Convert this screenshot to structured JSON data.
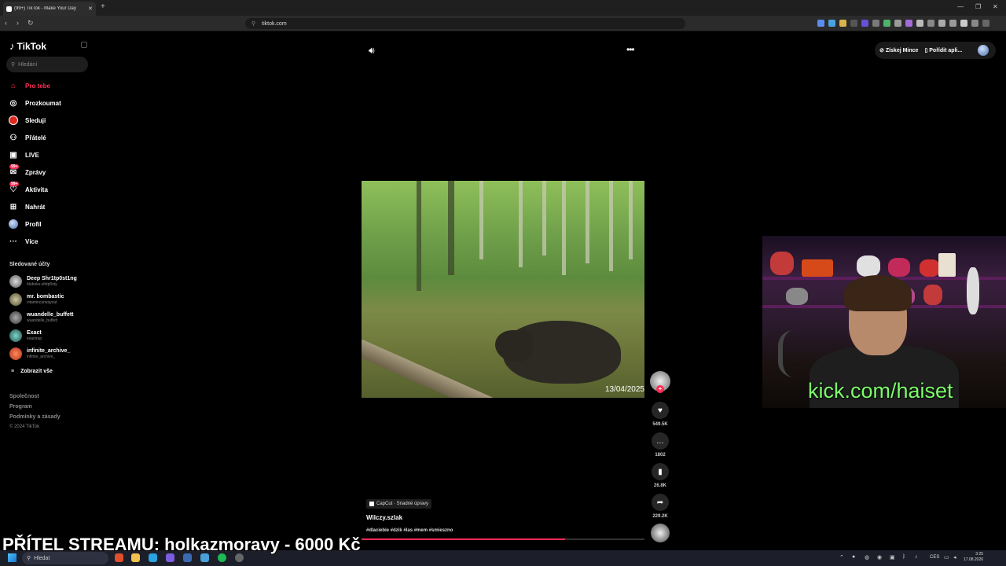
{
  "browser": {
    "tab_title": "(99+) TikTok - Make Your Day",
    "url": "tiktok.com"
  },
  "sidebar": {
    "logo": "TikTok",
    "search_placeholder": "Hledání",
    "nav": [
      {
        "label": "Pro tebe",
        "icon": "home-icon",
        "active": true
      },
      {
        "label": "Prozkoumat",
        "icon": "compass-icon"
      },
      {
        "label": "Sleduji",
        "icon": "following-icon"
      },
      {
        "label": "Přátelé",
        "icon": "friends-icon"
      },
      {
        "label": "LIVE",
        "icon": "live-icon"
      },
      {
        "label": "Zprávy",
        "icon": "messages-icon",
        "badge": "99+"
      },
      {
        "label": "Aktivita",
        "icon": "activity-icon",
        "badge": "99+"
      },
      {
        "label": "Nahrát",
        "icon": "upload-icon"
      },
      {
        "label": "Profil",
        "icon": "profile-icon"
      },
      {
        "label": "Více",
        "icon": "more-icon"
      }
    ],
    "followed_title": "Sledované účty",
    "accounts": [
      {
        "name": "Deep Shr1tp0st1ng",
        "handle": "hluboke.shitp0sty"
      },
      {
        "name": "mr. bombastic",
        "handle": "vitamincurwayout"
      },
      {
        "name": "wuandelle_buffett",
        "handle": "wuandelle_buffett"
      },
      {
        "name": "Exact",
        "handle": "exactrap"
      },
      {
        "name": "infinite_archive_",
        "handle": "infinite_archive_"
      }
    ],
    "show_all": "Zobrazit vše",
    "footer": [
      "Společnost",
      "Program",
      "Podmínky a zásady"
    ],
    "copyright": "© 2024 TikTok"
  },
  "header": {
    "coins_label": "Získej Mince",
    "get_app_label": "Pořídit apli..."
  },
  "video": {
    "timestamp": "13/04/2025",
    "capcut": "CapCut · Snadné úpravy",
    "author": "Wilczy.szlak",
    "tags": "#dlaciebie #dzik #las #mem #smieszno",
    "progress": 0.72
  },
  "actions": {
    "likes": "549.5K",
    "comments": "1802",
    "saves": "26.8K",
    "shares": "229.2K"
  },
  "webcam": {
    "overlay_text": "kick.com/haiset"
  },
  "stream": {
    "friend_banner": "PŘÍTEL STREAMU: holkazmoravy - 6000 Kč"
  },
  "taskbar": {
    "search": "Hledat",
    "lang": "CES",
    "time": "3:25",
    "date": "17.08.2026"
  }
}
